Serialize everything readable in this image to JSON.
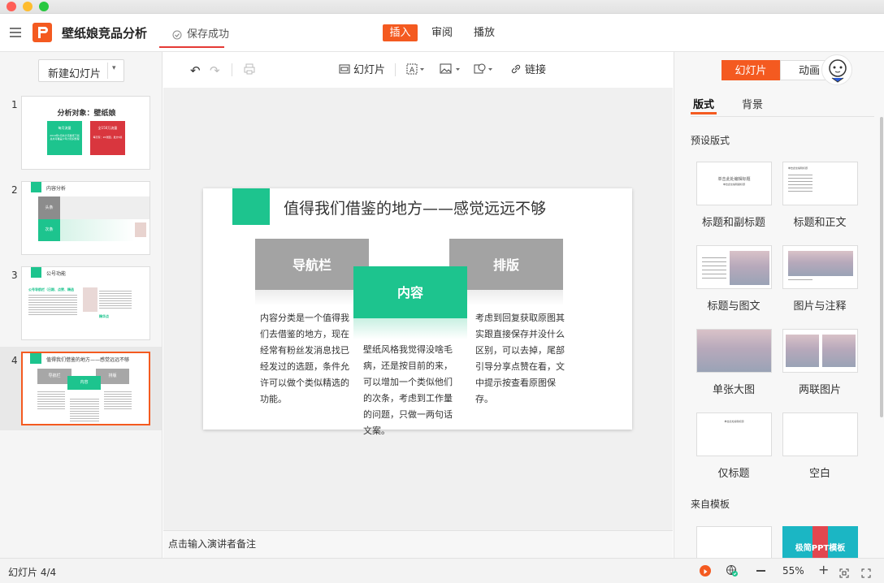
{
  "app": {
    "doc_title": "壁纸娘竞品分析",
    "save_status": "保存成功",
    "accent": "#f45a20",
    "green": "#1dc48e"
  },
  "menu": [
    "插入",
    "审阅",
    "播放"
  ],
  "toolbar": {
    "slide": "幻灯片",
    "link": "链接"
  },
  "left": {
    "new_slide": "新建幻灯片",
    "thumbs": [
      {
        "num": "1",
        "title": "分析对象：壁纸娘",
        "box1": "每月流量",
        "box1_text": "2019年1月共计高壁纸下载总共可覆盖少年小知识整理",
        "box2": "全150万流量",
        "box2_text": "每天有：20张图，发文5篇"
      },
      {
        "num": "2",
        "title": "内容分析",
        "row1": "头条",
        "row2": "次条"
      },
      {
        "num": "3",
        "title": "公号功能",
        "sub": "公号导航栏（日期、点赞、精选",
        "tag": "精华点"
      },
      {
        "num": "4",
        "title": "值得我们借鉴的地方——感觉远远不够",
        "b1": "导航栏",
        "b2": "内容",
        "b3": "排版"
      }
    ]
  },
  "slide": {
    "title": "值得我们借鉴的地方——感觉远远不够",
    "nav_label": "导航栏",
    "content_label": "内容",
    "layout_label": "排版",
    "text_left": "内容分类是一个值得我们去借鉴的地方，现在经常有粉丝发消息找已经发过的选题，条件允许可以做个类似精选的功能。",
    "text_mid": "壁纸风格我觉得没啥毛病，还是按目前的来，可以增加一个类似他们的次条，考虑到工作量的问题，只做一两句话文案。",
    "text_right": "考虑到回复获取原图其实跟直接保存并没什么区别，可以去掉，尾部引导分享点赞在看，文中提示按查看原图保存。"
  },
  "notes_placeholder": "点击输入演讲者备注",
  "right": {
    "tab_slide": "幻灯片",
    "tab_anim": "动画",
    "sub_layout": "版式",
    "sub_bg": "背景",
    "preset_heading": "预设版式",
    "layouts": [
      "标题和副标题",
      "标题和正文",
      "标题与图文",
      "图片与注释",
      "单张大图",
      "两联图片",
      "仅标题",
      "空白"
    ],
    "template_heading": "来自模板",
    "template_text": "极简PPT模板",
    "card_title_text": "单击此处编辑标题",
    "card_sub_text": "单击此处编辑副标题"
  },
  "status": {
    "slide_count": "幻灯片 4/4",
    "zoom": "55%"
  }
}
